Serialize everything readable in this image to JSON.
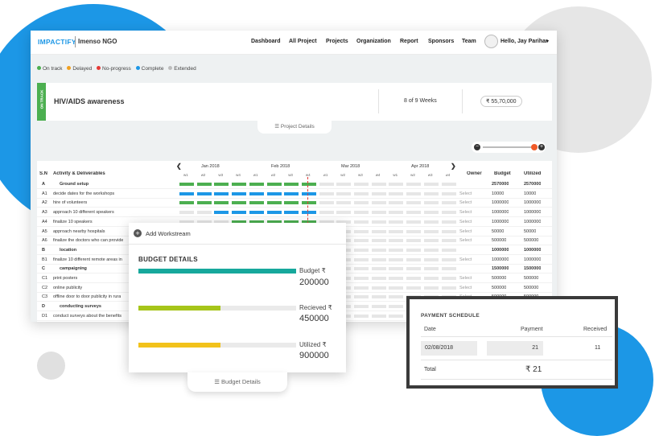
{
  "brand": {
    "logo": "IMPACTIFY",
    "org": "Imenso NGO"
  },
  "nav": [
    "Dashboard",
    "All Project",
    "Projects",
    "Organization",
    "Report",
    "Sponsors",
    "Team"
  ],
  "user": {
    "greeting": "Hello, Jay Parihar",
    "caret": "▾"
  },
  "legend": [
    {
      "label": "On track",
      "color": "#4caf50"
    },
    {
      "label": "Delayed",
      "color": "#f0a020"
    },
    {
      "label": "No-progress",
      "color": "#e53935"
    },
    {
      "label": "Complete",
      "color": "#1c97e6"
    },
    {
      "label": "Extended",
      "color": "#bdbdbd"
    }
  ],
  "project": {
    "status": "ON TRACK",
    "title": "HIV/AIDS awareness",
    "weeks": "8 of 9 Weeks",
    "amount": "₹ 55,70,000"
  },
  "project_details_label": "Project Details",
  "gantt": {
    "headers": {
      "sn": "S.N",
      "activity": "Activity & Deliverables",
      "owner": "Owner",
      "budget": "Budget",
      "utilized": "Utilized"
    },
    "months": [
      "Jan 2018",
      "Feb 2018",
      "Mar 2018",
      "Apr 2018"
    ],
    "weeks": [
      "w1",
      "w2",
      "w3",
      "w4"
    ],
    "prev": "❮",
    "next": "❯",
    "rows": [
      {
        "sn": "A",
        "activity": "Ground setup",
        "group": true,
        "budget": "2570000",
        "utilized": "2570000",
        "bars": "gggggggg"
      },
      {
        "sn": "A1",
        "activity": "decide dates for the workshops",
        "owner": "Select",
        "budget": "10000",
        "utilized": "10000",
        "bars": "bbbbbbbb"
      },
      {
        "sn": "A2",
        "activity": "hire of volunteers",
        "owner": "Select",
        "budget": "1000000",
        "utilized": "1000000",
        "bars": "gggggggg"
      },
      {
        "sn": "A3",
        "activity": "approach 10 different speakers",
        "owner": "Select",
        "budget": "1000000",
        "utilized": "1000000",
        "bars": "..bbbbbb"
      },
      {
        "sn": "A4",
        "activity": "finalize 10 speakers",
        "owner": "Select",
        "budget": "1000000",
        "utilized": "1000000",
        "bars": "...ggggg"
      },
      {
        "sn": "A5",
        "activity": "approach nearby hospitals",
        "owner": "Select",
        "budget": "50000",
        "utilized": "50000",
        "bars": "..bbbbbb"
      },
      {
        "sn": "A6",
        "activity": "finalize the doctors who can provide",
        "owner": "Select",
        "budget": "500000",
        "utilized": "500000",
        "bars": "..gggggg"
      },
      {
        "sn": "B",
        "activity": "location",
        "group": true,
        "budget": "1000000",
        "utilized": "1000000",
        "bars": ""
      },
      {
        "sn": "B1",
        "activity": "finalize 10 different remote areas in",
        "owner": "Select",
        "budget": "1000000",
        "utilized": "1000000",
        "bars": ""
      },
      {
        "sn": "C",
        "activity": "campaigning",
        "group": true,
        "budget": "1500000",
        "utilized": "1500000",
        "bars": ""
      },
      {
        "sn": "C1",
        "activity": "print posters",
        "owner": "Select",
        "budget": "500000",
        "utilized": "500000",
        "bars": ""
      },
      {
        "sn": "C2",
        "activity": "online publicity",
        "owner": "Select",
        "budget": "500000",
        "utilized": "500000",
        "bars": ""
      },
      {
        "sn": "C3",
        "activity": "offline door to door publicity in rura",
        "owner": "Select",
        "budget": "500000",
        "utilized": "500000",
        "bars": ""
      },
      {
        "sn": "D",
        "activity": "conducting surveys",
        "group": true,
        "budget": "500000",
        "utilized": "500000",
        "bars": ""
      },
      {
        "sn": "D1",
        "activity": "conduct surveys about the benefits",
        "owner": "Select",
        "budget": "500000",
        "utilized": "500000",
        "bars": ""
      }
    ]
  },
  "workstream": {
    "add_label": "Add Workstream",
    "plus": "+"
  },
  "budget": {
    "title": "BUDGET DETAILS",
    "items": [
      {
        "label": "Budget ₹",
        "value": "200000",
        "fill": 1.0,
        "color": "#16a89c"
      },
      {
        "label": "Recieved ₹",
        "value": "450000",
        "fill": 0.52,
        "color": "#a6c51a"
      },
      {
        "label": "Utilized ₹",
        "value": "900000",
        "fill": 0.52,
        "color": "#f2c21b"
      }
    ],
    "tab_label": "Budget Details"
  },
  "payment": {
    "title": "PAYMENT SCHEDULE",
    "headers": {
      "date": "Date",
      "payment": "Payment",
      "received": "Received"
    },
    "row": {
      "date": "02/08/2018",
      "payment": "21",
      "received": "11"
    },
    "total_label": "Total",
    "total_value": "₹ 21"
  },
  "slider": {
    "minus": "−",
    "plus": "+"
  }
}
